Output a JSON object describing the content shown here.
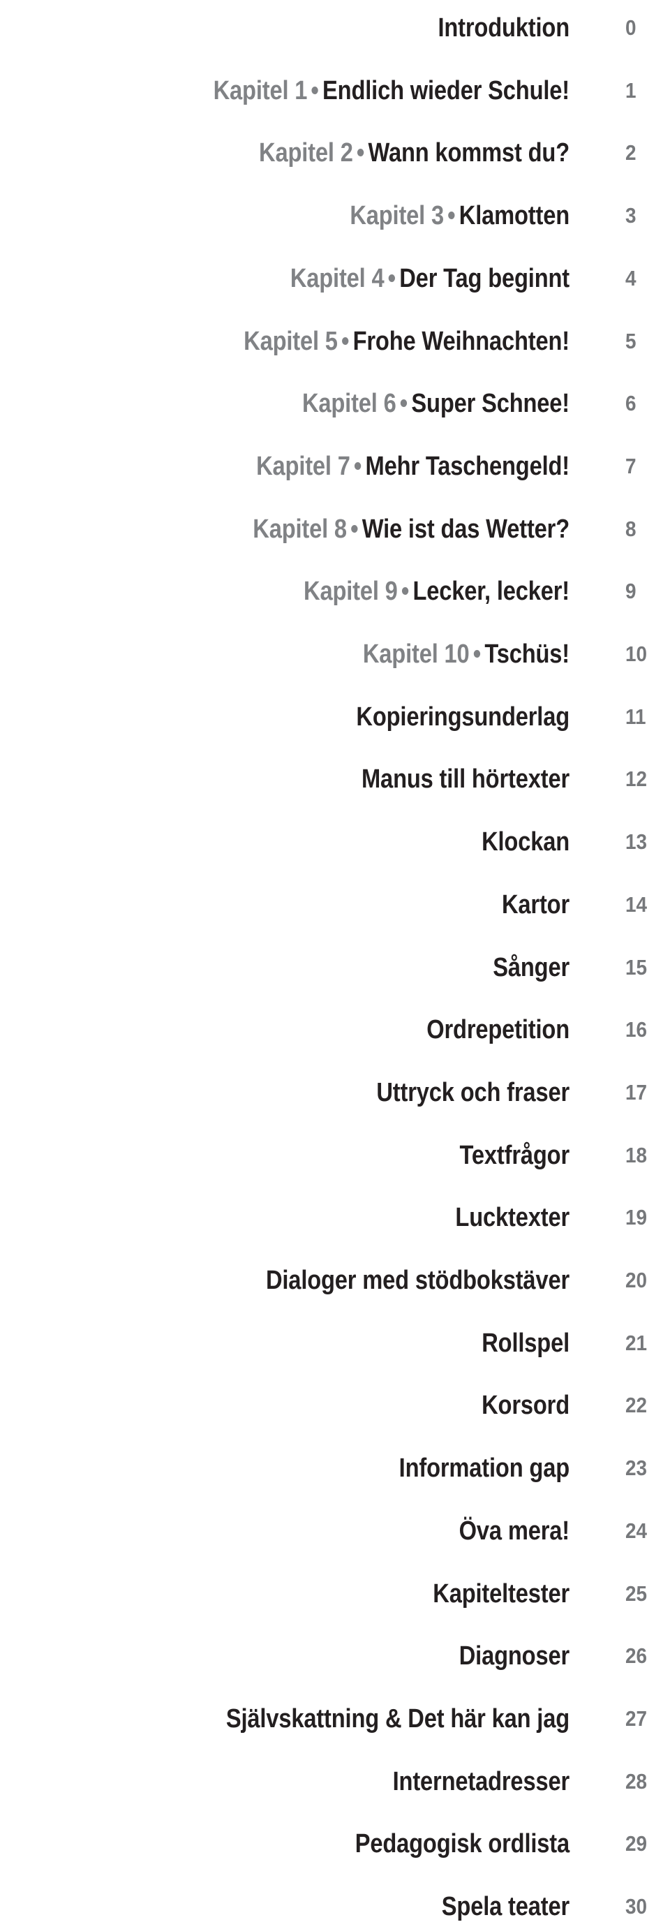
{
  "document": {
    "type": "table-of-contents",
    "language_mix": [
      "German",
      "Swedish"
    ],
    "colors": {
      "title_text": "#231f20",
      "chapter_prefix": "#808285",
      "page_number": "#76787b",
      "background": "#ffffff"
    },
    "separator_glyph": "•"
  },
  "entries": [
    {
      "prefix": "",
      "separator": "",
      "title": "Introduktion",
      "page": "0"
    },
    {
      "prefix": "Kapitel 1",
      "separator": "•",
      "title": "Endlich wieder Schule!",
      "page": "1"
    },
    {
      "prefix": "Kapitel 2",
      "separator": "•",
      "title": "Wann kommst du?",
      "page": "2"
    },
    {
      "prefix": "Kapitel 3",
      "separator": "•",
      "title": "Klamotten",
      "page": "3"
    },
    {
      "prefix": "Kapitel 4",
      "separator": "•",
      "title": "Der Tag beginnt",
      "page": "4"
    },
    {
      "prefix": "Kapitel 5",
      "separator": "•",
      "title": "Frohe Weihnachten!",
      "page": "5"
    },
    {
      "prefix": "Kapitel 6",
      "separator": "•",
      "title": "Super Schnee!",
      "page": "6"
    },
    {
      "prefix": "Kapitel 7",
      "separator": "•",
      "title": "Mehr Taschengeld!",
      "page": "7"
    },
    {
      "prefix": "Kapitel 8",
      "separator": "•",
      "title": "Wie ist das Wetter?",
      "page": "8"
    },
    {
      "prefix": "Kapitel 9",
      "separator": "•",
      "title": "Lecker, lecker!",
      "page": "9"
    },
    {
      "prefix": "Kapitel 10",
      "separator": "•",
      "title": "Tschüs!",
      "page": "10"
    },
    {
      "prefix": "",
      "separator": "",
      "title": "Kopieringsunderlag",
      "page": "11"
    },
    {
      "prefix": "",
      "separator": "",
      "title": "Manus till hörtexter",
      "page": "12"
    },
    {
      "prefix": "",
      "separator": "",
      "title": "Klockan",
      "page": "13"
    },
    {
      "prefix": "",
      "separator": "",
      "title": "Kartor",
      "page": "14"
    },
    {
      "prefix": "",
      "separator": "",
      "title": "Sånger",
      "page": "15"
    },
    {
      "prefix": "",
      "separator": "",
      "title": "Ordrepetition",
      "page": "16"
    },
    {
      "prefix": "",
      "separator": "",
      "title": "Uttryck och fraser",
      "page": "17"
    },
    {
      "prefix": "",
      "separator": "",
      "title": "Textfrågor",
      "page": "18"
    },
    {
      "prefix": "",
      "separator": "",
      "title": "Lucktexter",
      "page": "19"
    },
    {
      "prefix": "",
      "separator": "",
      "title": "Dialoger med stödbokstäver",
      "page": "20"
    },
    {
      "prefix": "",
      "separator": "",
      "title": "Rollspel",
      "page": "21"
    },
    {
      "prefix": "",
      "separator": "",
      "title": "Korsord",
      "page": "22"
    },
    {
      "prefix": "",
      "separator": "",
      "title": "Information gap",
      "page": "23"
    },
    {
      "prefix": "",
      "separator": "",
      "title": "Öva mera!",
      "page": "24"
    },
    {
      "prefix": "",
      "separator": "",
      "title": "Kapiteltester",
      "page": "25"
    },
    {
      "prefix": "",
      "separator": "",
      "title": "Diagnoser",
      "page": "26"
    },
    {
      "prefix": "",
      "separator": "",
      "title": "Självskattning & Det här kan jag",
      "page": "27"
    },
    {
      "prefix": "",
      "separator": "",
      "title": "Internetadresser",
      "page": "28"
    },
    {
      "prefix": "",
      "separator": "",
      "title": "Pedagogisk ordlista",
      "page": "29"
    },
    {
      "prefix": "",
      "separator": "",
      "title": "Spela teater",
      "page": "30"
    }
  ]
}
